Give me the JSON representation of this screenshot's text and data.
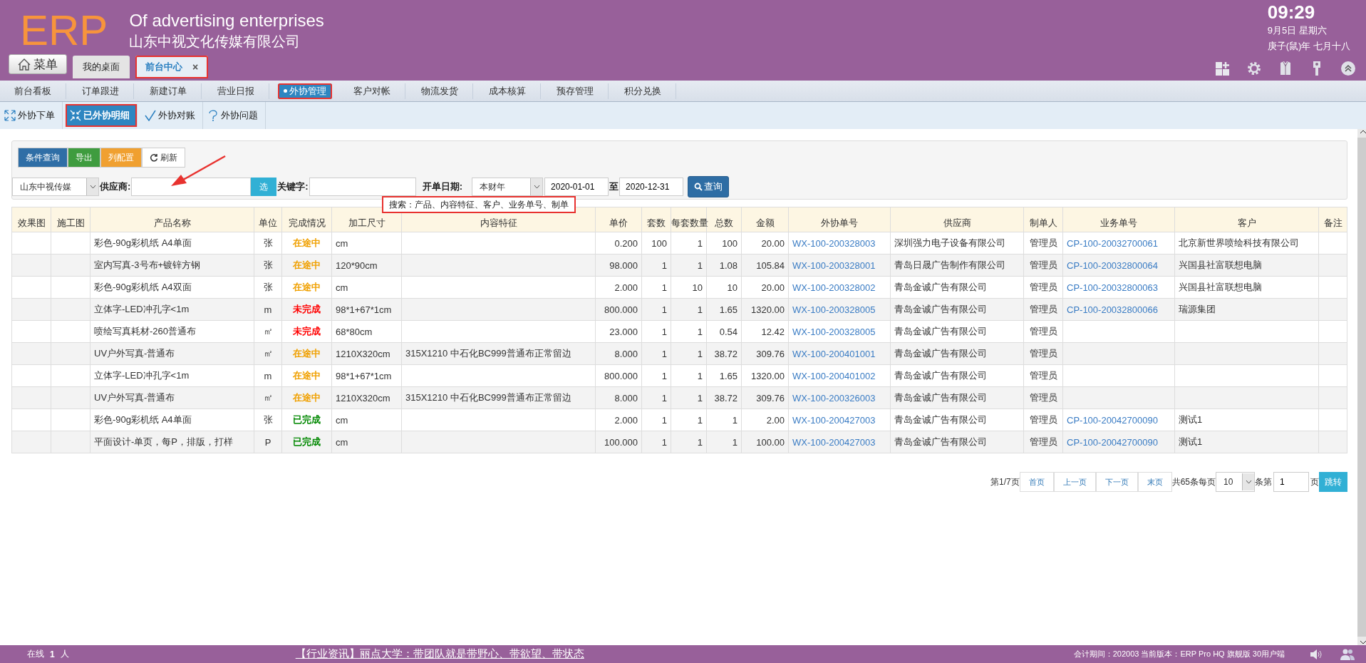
{
  "header": {
    "logo": "ERP",
    "title_en": "Of advertising enterprises",
    "title_cn": "山东中视文化传媒有限公司",
    "menu_button": "菜单",
    "clock": {
      "time": "09:29",
      "date": "9月5日 星期六",
      "lunar": "庚子(鼠)年 七月十八"
    }
  },
  "tabs": [
    {
      "label": "我的桌面",
      "selected": false,
      "highlighted": false
    },
    {
      "label": "前台中心",
      "selected": true,
      "highlighted": true,
      "close": "×"
    }
  ],
  "nav": [
    {
      "label": "前台看板",
      "selected": false,
      "highlighted": false
    },
    {
      "label": "订单跟进",
      "selected": false,
      "highlighted": false
    },
    {
      "label": "新建订单",
      "selected": false,
      "highlighted": false
    },
    {
      "label": "营业日报",
      "selected": false,
      "highlighted": false
    },
    {
      "label": "外协管理",
      "selected": true,
      "highlighted": true
    },
    {
      "label": "客户对帐",
      "selected": false,
      "highlighted": false
    },
    {
      "label": "物流发货",
      "selected": false,
      "highlighted": false
    },
    {
      "label": "成本核算",
      "selected": false,
      "highlighted": false
    },
    {
      "label": "预存管理",
      "selected": false,
      "highlighted": false
    },
    {
      "label": "积分兑换",
      "selected": false,
      "highlighted": false
    }
  ],
  "subnav": [
    {
      "label": "外协下单",
      "kind": "expand",
      "selected": false,
      "highlighted": false
    },
    {
      "label": "已外协明细",
      "kind": "collapse",
      "selected": true,
      "highlighted": true
    },
    {
      "label": "外协对账",
      "kind": "check",
      "selected": false,
      "highlighted": false
    },
    {
      "label": "外协问题",
      "kind": "question",
      "selected": false,
      "highlighted": false
    }
  ],
  "toolbar": [
    {
      "label": "条件查询",
      "kind": "plain",
      "color": "#2f6ea6"
    },
    {
      "label": "导出",
      "kind": "plain",
      "color": "#3f9c3f"
    },
    {
      "label": "列配置",
      "kind": "plain",
      "color": "#f0a030"
    },
    {
      "label": "刷新",
      "kind": "refresh",
      "color": "#ffffff"
    }
  ],
  "filters": {
    "company": "山东中视传媒",
    "supplier_label": "供应商:",
    "pick_button": "选",
    "keyword_label": "关键字:",
    "date_label": "开单日期:",
    "period": "本财年",
    "date_from": "2020-01-01",
    "to_label": "至",
    "date_to": "2020-12-31",
    "search_button": "查询",
    "tooltip": {
      "text": "搜索：产品、内容特征、客户、业务单号、制单",
      "highlighted": true
    }
  },
  "table": {
    "columns": [
      "效果图",
      "施工图",
      "产品名称",
      "单位",
      "完成情况",
      "加工尺寸",
      "内容特征",
      "单价",
      "套数",
      "每套数量",
      "总数",
      "金额",
      "外协单号",
      "供应商",
      "制单人",
      "业务单号",
      "客户",
      "备注"
    ],
    "rows": [
      {
        "product": "彩色-90g彩机纸 A4单面",
        "unit": "张",
        "status": {
          "text": "在途中",
          "color": "#f0a000"
        },
        "size": "cm",
        "price": "0.200",
        "sets": "100",
        "per_set": "1",
        "total": "100",
        "amount": "20.00",
        "wx_no": "WX-100-200328003",
        "supplier": "深圳强力电子设备有限公司",
        "creator": "管理员",
        "cp_no": "CP-100-20032700061",
        "customer": "北京新世界喷绘科技有限公司"
      },
      {
        "product": "室内写真-3号布+镀锌方钢",
        "unit": "张",
        "status": {
          "text": "在途中",
          "color": "#f0a000"
        },
        "size": "120*90cm",
        "price": "98.000",
        "sets": "1",
        "per_set": "1",
        "total": "1.08",
        "amount": "105.84",
        "wx_no": "WX-100-200328001",
        "supplier": "青岛日晟广告制作有限公司",
        "creator": "管理员",
        "cp_no": "CP-100-20032800064",
        "customer": "兴国县社富联想电脑"
      },
      {
        "product": "彩色-90g彩机纸 A4双面",
        "unit": "张",
        "status": {
          "text": "在途中",
          "color": "#f0a000"
        },
        "size": "cm",
        "price": "2.000",
        "sets": "1",
        "per_set": "10",
        "total": "10",
        "amount": "20.00",
        "wx_no": "WX-100-200328002",
        "supplier": "青岛金诚广告有限公司",
        "creator": "管理员",
        "cp_no": "CP-100-20032800063",
        "customer": "兴国县社富联想电脑"
      },
      {
        "product": "立体字-LED冲孔字<1m",
        "unit": "m",
        "status": {
          "text": "未完成",
          "color": "#ff0000"
        },
        "size": "98*1+67*1cm",
        "price": "800.000",
        "sets": "1",
        "per_set": "1",
        "total": "1.65",
        "amount": "1320.00",
        "wx_no": "WX-100-200328005",
        "supplier": "青岛金诚广告有限公司",
        "creator": "管理员",
        "cp_no": "CP-100-20032800066",
        "customer": "瑞源集团"
      },
      {
        "product": "喷绘写真耗材-260普通布",
        "unit": "㎡",
        "status": {
          "text": "未完成",
          "color": "#ff0000"
        },
        "size": "68*80cm",
        "price": "23.000",
        "sets": "1",
        "per_set": "1",
        "total": "0.54",
        "amount": "12.42",
        "wx_no": "WX-100-200328005",
        "supplier": "青岛金诚广告有限公司",
        "creator": "管理员"
      },
      {
        "product": "UV户外写真-普通布",
        "unit": "㎡",
        "status": {
          "text": "在途中",
          "color": "#f0a000"
        },
        "size": "1210X320cm",
        "content": "315X1210 中石化BC999普通布正常留边",
        "price": "8.000",
        "sets": "1",
        "per_set": "1",
        "total": "38.72",
        "amount": "309.76",
        "wx_no": "WX-100-200401001",
        "supplier": "青岛金诚广告有限公司",
        "creator": "管理员"
      },
      {
        "product": "立体字-LED冲孔字<1m",
        "unit": "m",
        "status": {
          "text": "在途中",
          "color": "#f0a000"
        },
        "size": "98*1+67*1cm",
        "price": "800.000",
        "sets": "1",
        "per_set": "1",
        "total": "1.65",
        "amount": "1320.00",
        "wx_no": "WX-100-200401002",
        "supplier": "青岛金诚广告有限公司",
        "creator": "管理员"
      },
      {
        "product": "UV户外写真-普通布",
        "unit": "㎡",
        "status": {
          "text": "在途中",
          "color": "#f0a000"
        },
        "size": "1210X320cm",
        "content": "315X1210 中石化BC999普通布正常留边",
        "price": "8.000",
        "sets": "1",
        "per_set": "1",
        "total": "38.72",
        "amount": "309.76",
        "wx_no": "WX-100-200326003",
        "supplier": "青岛金诚广告有限公司",
        "creator": "管理员"
      },
      {
        "product": "彩色-90g彩机纸 A4单面",
        "unit": "张",
        "status": {
          "text": "已完成",
          "color": "#008800"
        },
        "size": "cm",
        "price": "2.000",
        "sets": "1",
        "per_set": "1",
        "total": "1",
        "amount": "2.00",
        "wx_no": "WX-100-200427003",
        "supplier": "青岛金诚广告有限公司",
        "creator": "管理员",
        "cp_no": "CP-100-20042700090",
        "customer": "测试1"
      },
      {
        "product": "平面设计-单页，每P，排版，打样",
        "unit": "P",
        "status": {
          "text": "已完成",
          "color": "#008800"
        },
        "size": "cm",
        "price": "100.000",
        "sets": "1",
        "per_set": "1",
        "total": "1",
        "amount": "100.00",
        "wx_no": "WX-100-200427003",
        "supplier": "青岛金诚广告有限公司",
        "creator": "管理员",
        "cp_no": "CP-100-20042700090",
        "customer": "测试1"
      }
    ]
  },
  "pagination": {
    "page_info": "第1/7页",
    "buttons": [
      "首页",
      "上一页",
      "下一页",
      "末页"
    ],
    "total_label": "共65条每页",
    "page_size": "10",
    "page_label": "条第",
    "page_input": "1",
    "page_suffix": "页",
    "jump_button": "跳转"
  },
  "status_bar": {
    "online_label": "在线",
    "online_count": "1",
    "online_unit": "人",
    "news": "【行业资讯】丽点大学：带团队就是带野心、带欲望、带状态",
    "info": "会计期间：202003 当前版本：ERP Pro HQ 旗舰版 30用户端"
  }
}
